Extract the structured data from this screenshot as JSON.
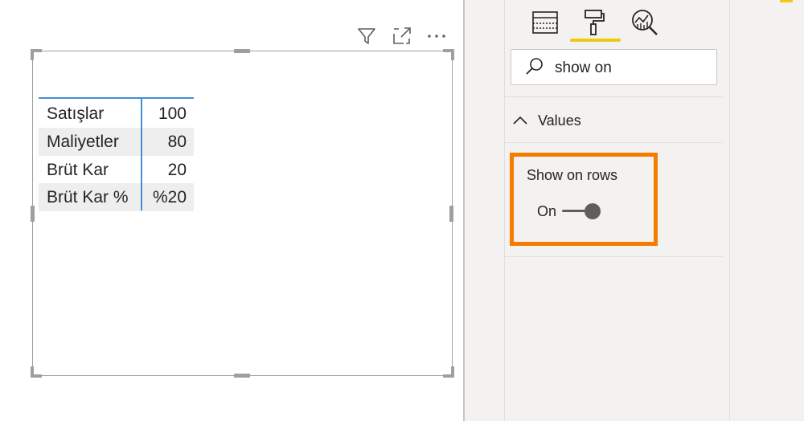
{
  "canvas": {
    "visual_header": {
      "filter_icon": "filter-icon",
      "focus_icon": "focus-mode-icon",
      "more_icon": "more-options-icon"
    },
    "table": {
      "rows": [
        {
          "label": "Satışlar",
          "value": "100"
        },
        {
          "label": "Maliyetler",
          "value": "80"
        },
        {
          "label": "Brüt Kar",
          "value": "20"
        },
        {
          "label": "Brüt Kar %",
          "value": "%20"
        }
      ]
    }
  },
  "pane": {
    "tabs": [
      {
        "icon": "fields-icon"
      },
      {
        "icon": "format-paint-roller-icon",
        "active": true
      },
      {
        "icon": "analytics-icon"
      }
    ],
    "search": {
      "value": "show on",
      "icon": "search-icon"
    },
    "section": {
      "label": "Values",
      "expanded": true
    },
    "setting": {
      "label": "Show on rows",
      "toggle_state": "On",
      "toggle_on": true
    }
  },
  "colors": {
    "accent_yellow": "#f2c811",
    "highlight_orange": "#f57c00",
    "table_line_blue": "#3f8fd6"
  }
}
